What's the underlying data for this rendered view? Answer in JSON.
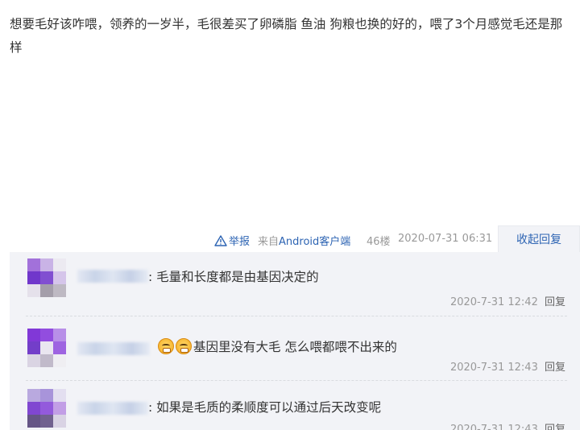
{
  "post": {
    "content": "想要毛好该咋喂，领养的一岁半，毛很差买了卵磷脂 鱼油 狗粮也换的好的，喂了3个月感觉毛还是那样"
  },
  "meta": {
    "report_label": "举报",
    "source_prefix": "来自",
    "source_client": "Android客户端",
    "floor": "46楼",
    "time": "2020-07-31 06:31",
    "collapse_label": "收起回复"
  },
  "replies": [
    {
      "colon": ":",
      "text": "毛量和长度都是由基因决定的",
      "time": "2020-7-31 12:42",
      "reply_label": "回复",
      "emojis": []
    },
    {
      "colon": "",
      "text": "基因里没有大毛 怎么喂都喂不出来的",
      "time": "2020-7-31 12:43",
      "reply_label": "回复",
      "emojis": [
        "laughing-face-icon",
        "laughing-face-icon"
      ]
    },
    {
      "colon": ":",
      "text": "如果是毛质的柔顺度可以通过后天改变呢",
      "time": "2020-7-31 12:43",
      "reply_label": "回复",
      "emojis": []
    }
  ],
  "colors": {
    "link_blue": "#2d64b3",
    "muted_gray": "#999999",
    "panel_bg": "#f2f3f7"
  }
}
